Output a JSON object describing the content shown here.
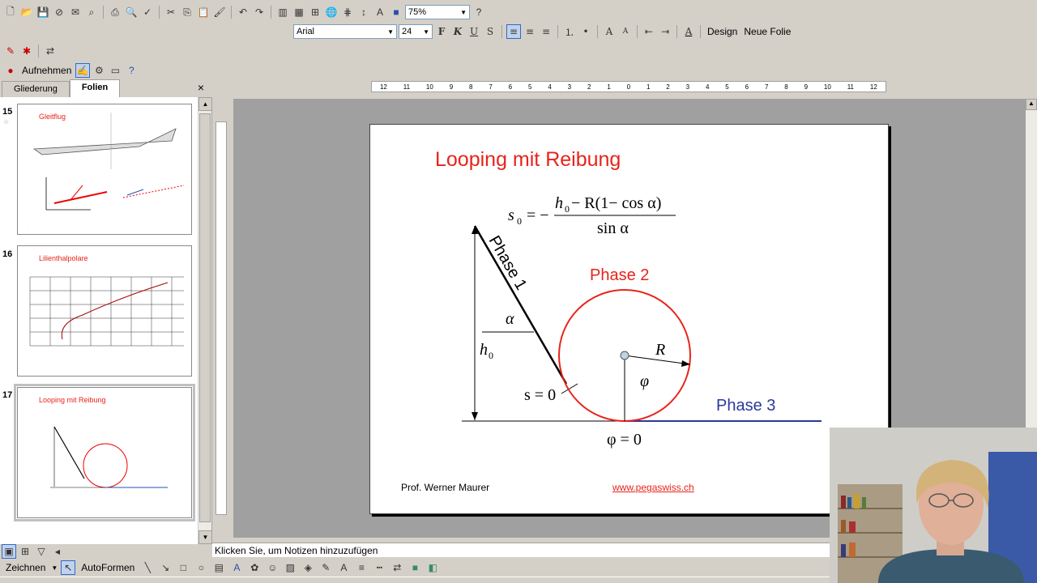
{
  "toolbar1": {
    "zoom": "75%",
    "help_icon": "help-icon"
  },
  "toolbar2": {
    "font": "Arial",
    "size": "24",
    "bold": "F",
    "italic": "K",
    "underline": "U",
    "shadow": "S",
    "design_label": "Design",
    "new_slide_label": "Neue Folie"
  },
  "toolbar3": {
    "record_label": "Aufnehmen"
  },
  "panel": {
    "tab_outline": "Gliederung",
    "tab_slides": "Folien",
    "close": "×"
  },
  "slides": [
    {
      "num": "15",
      "title": "Gleitflug"
    },
    {
      "num": "16",
      "title": "Lilienthalpolare"
    },
    {
      "num": "17",
      "title": "Looping mit Reibung"
    }
  ],
  "ruler": {
    "h_labels": [
      "12",
      "11",
      "10",
      "9",
      "8",
      "7",
      "6",
      "5",
      "4",
      "3",
      "2",
      "1",
      "0",
      "1",
      "2",
      "3",
      "4",
      "5",
      "6",
      "7",
      "8",
      "9",
      "10",
      "11",
      "12"
    ]
  },
  "slide": {
    "title": "Looping mit Reibung",
    "phase1": "Phase 1",
    "phase2": "Phase 2",
    "phase3": "Phase 3",
    "alpha": "α",
    "h0": "h",
    "h0_sub": "0",
    "s0_eq": "s = 0",
    "R": "R",
    "phi": "φ",
    "phi_eq": "φ = 0",
    "footer_left": "Prof. Werner Maurer",
    "footer_right": "www.pegaswiss.ch",
    "formula_lhs": "s",
    "formula_lhs_sub": "0",
    "formula_eq": "= −",
    "formula_num": "h",
    "formula_num_sub": "0",
    "formula_num_rest": " − R(1− cos α)",
    "formula_den": "sin α"
  },
  "notes_placeholder": "Klicken Sie, um Notizen hinzuzufügen",
  "drawbar": {
    "draw_label": "Zeichnen",
    "autoshapes_label": "AutoFormen"
  }
}
